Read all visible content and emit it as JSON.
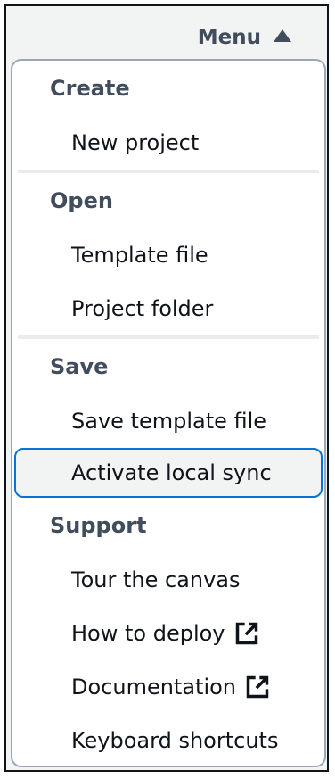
{
  "menu": {
    "trigger_label": "Menu",
    "groups": [
      {
        "header": "Create",
        "items": [
          {
            "label": "New project"
          }
        ]
      },
      {
        "header": "Open",
        "items": [
          {
            "label": "Template file"
          },
          {
            "label": "Project folder"
          }
        ]
      },
      {
        "header": "Save",
        "items": [
          {
            "label": "Save template file"
          },
          {
            "label": "Activate local sync",
            "highlighted": true
          }
        ]
      },
      {
        "header": "Support",
        "items": [
          {
            "label": "Tour the canvas"
          },
          {
            "label": "How to deploy",
            "icon": "external-link-icon"
          },
          {
            "label": "Documentation",
            "icon": "external-link-icon"
          },
          {
            "label": "Keyboard shortcuts"
          }
        ]
      }
    ]
  },
  "colors": {
    "focus_border": "#0972d3",
    "header_text": "#414d5c",
    "item_text": "#0f141a"
  }
}
